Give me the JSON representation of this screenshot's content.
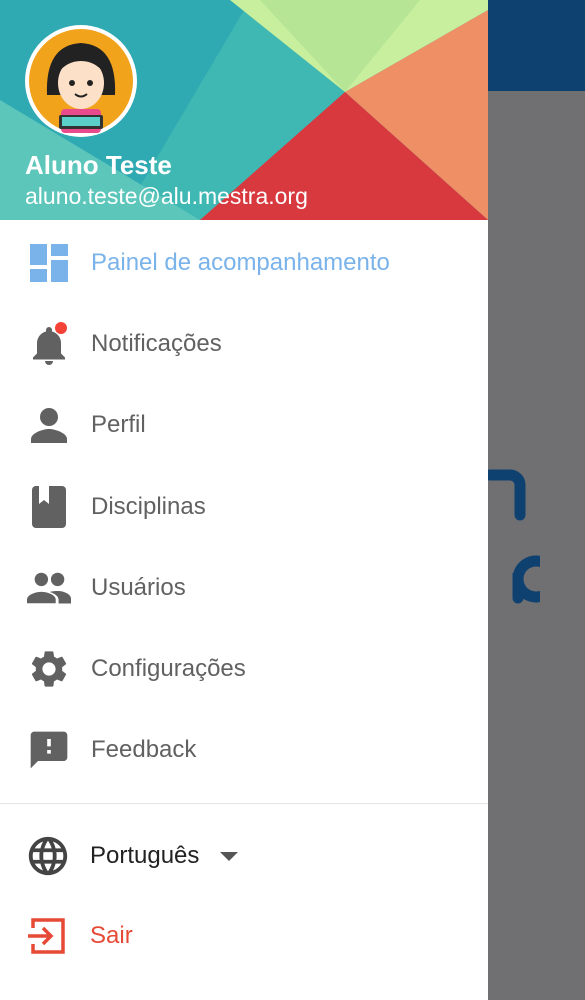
{
  "user": {
    "name": "Aluno Teste",
    "email": "aluno.teste@alu.mestra.org"
  },
  "menu": {
    "items": [
      {
        "label": "Painel de acompanhamento",
        "icon": "dashboard-icon",
        "active": true
      },
      {
        "label": "Notificações",
        "icon": "bell-icon",
        "badge": true
      },
      {
        "label": "Perfil",
        "icon": "person-icon"
      },
      {
        "label": "Disciplinas",
        "icon": "book-icon"
      },
      {
        "label": "Usuários",
        "icon": "people-icon"
      },
      {
        "label": "Configurações",
        "icon": "gear-icon"
      },
      {
        "label": "Feedback",
        "icon": "feedback-icon"
      }
    ]
  },
  "language": {
    "label": "Português",
    "icon": "globe-icon"
  },
  "logout": {
    "label": "Sair",
    "icon": "logout-icon"
  },
  "colors": {
    "active": "#7ab3ea",
    "text": "#616161",
    "logout": "#e64a36",
    "badge": "#f44336",
    "topbar": "#0f4170"
  }
}
